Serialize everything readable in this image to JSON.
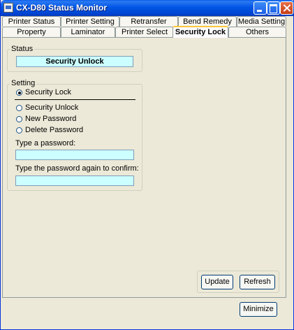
{
  "window": {
    "title": "CX-D80 Status Monitor"
  },
  "tabs_row1": [
    "Printer Status",
    "Printer Setting",
    "Retransfer",
    "Bend Remedy",
    "Media Setting"
  ],
  "tabs_row2": [
    "Property",
    "Laminator",
    "Printer Select",
    "Security Lock",
    "Others"
  ],
  "active_tab": "Security Lock",
  "status_group": {
    "label": "Status",
    "value": "Security Unlock"
  },
  "setting_group": {
    "label": "Setting",
    "options": [
      "Security Lock",
      "Security Unlock",
      "New Password",
      "Delete Password"
    ],
    "selected": "Security Lock",
    "password_label": "Type a password:",
    "password_value": "",
    "confirm_label": "Type the password again to confirm:",
    "confirm_value": ""
  },
  "buttons": {
    "update": "Update",
    "refresh": "Refresh",
    "minimize": "Minimize"
  },
  "colors": {
    "field_bg": "#ccffff",
    "titlebar": "#0055e5",
    "face": "#ece9d8"
  }
}
